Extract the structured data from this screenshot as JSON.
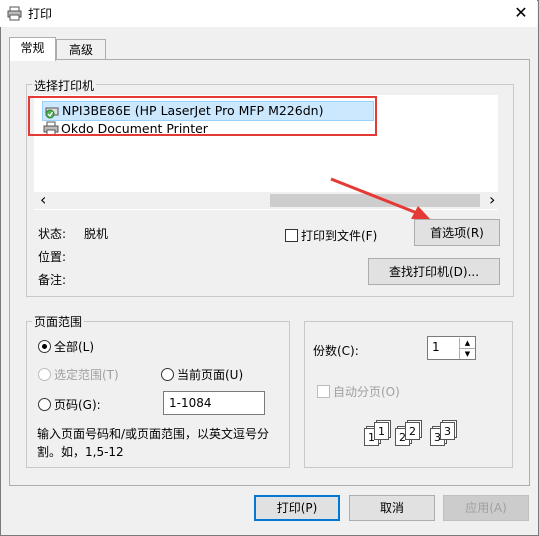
{
  "window": {
    "title": "打印",
    "close_glyph": "✕"
  },
  "tabs": [
    {
      "label": "常规"
    },
    {
      "label": "高级"
    }
  ],
  "select_printer": {
    "label": "选择打印机",
    "printers": [
      {
        "name": "NPI3BE86E (HP LaserJet Pro MFP M226dn)"
      },
      {
        "name": "Okdo Document Printer"
      }
    ],
    "scroll_left": "‹",
    "scroll_right": "›"
  },
  "status": {
    "status_label": "状态:",
    "status_value": "脱机",
    "location_label": "位置:",
    "comment_label": "备注:"
  },
  "print_to_file_label": "打印到文件(F)",
  "preferences_button": "首选项(R)",
  "find_printer_button": "查找打印机(D)...",
  "page_range": {
    "label": "页面范围",
    "all": "全部(L)",
    "selection": "选定范围(T)",
    "current_page": "当前页面(U)",
    "pages": "页码(G):",
    "pages_value": "1-1084",
    "hint": "输入页面号码和/或页面范围，以英文逗号分割。如，1,5-12"
  },
  "copies": {
    "label": "份数(C):",
    "value": "1",
    "collate_label": "自动分页(O)",
    "collate_pages": [
      "1",
      "1",
      "2",
      "2",
      "3",
      "3"
    ]
  },
  "footer": {
    "print": "打印(P)",
    "cancel": "取消",
    "apply": "应用(A)"
  },
  "colors": {
    "accent": "#0078d7",
    "annotation": "#e53935",
    "selection": "#cce8ff"
  }
}
